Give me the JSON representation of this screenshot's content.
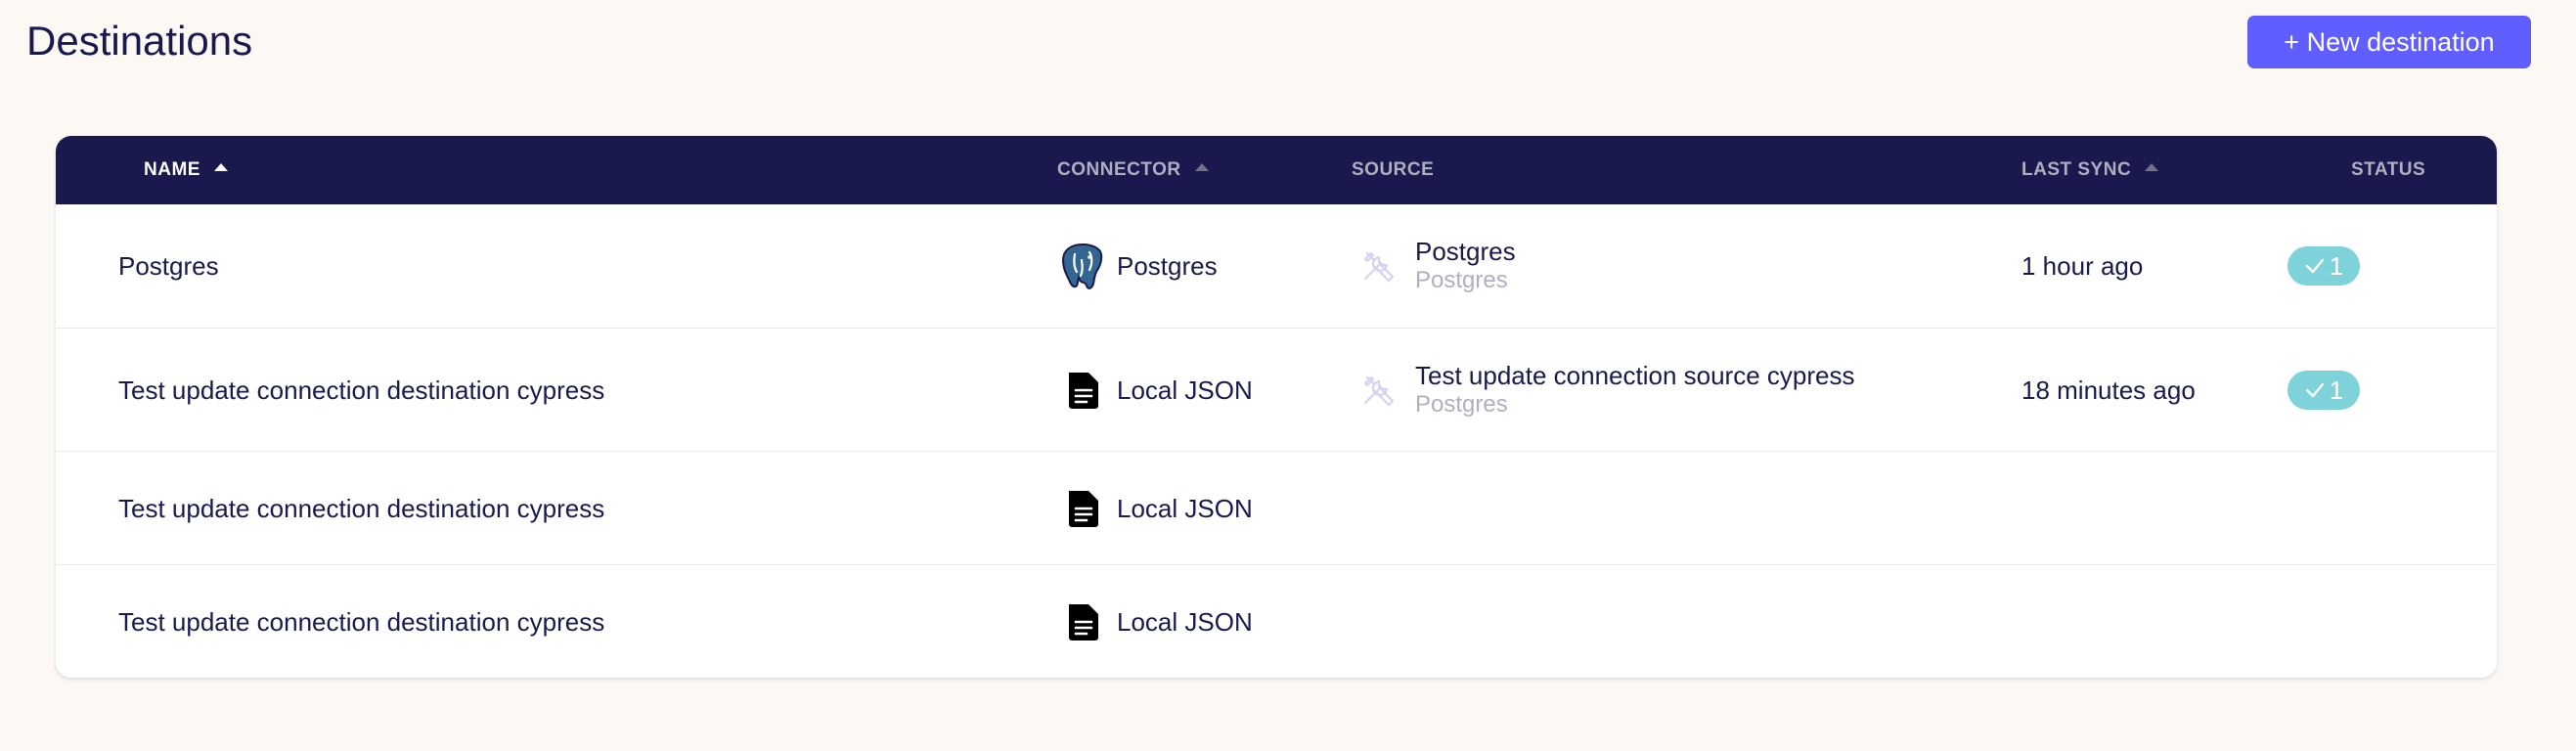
{
  "header": {
    "title": "Destinations",
    "new_button_label": "+ New destination"
  },
  "table": {
    "columns": {
      "name": "NAME",
      "connector": "CONNECTOR",
      "source": "SOURCE",
      "last_sync": "LAST SYNC",
      "status": "STATUS"
    },
    "sort": {
      "active_column": "name",
      "direction": "ascending"
    },
    "rows": [
      {
        "name": "Postgres",
        "connector": "Postgres",
        "connector_icon": "postgres-elephant-icon",
        "source_name": "Postgres",
        "source_type": "Postgres",
        "source_icon": "tools-icon",
        "last_sync": "1 hour ago",
        "status_count": "1",
        "status_icon": "check-icon"
      },
      {
        "name": "Test update connection destination cypress",
        "connector": "Local JSON",
        "connector_icon": "file-document-icon",
        "source_name": "Test update connection source cypress",
        "source_type": "Postgres",
        "source_icon": "tools-icon",
        "last_sync": "18 minutes ago",
        "status_count": "1",
        "status_icon": "check-icon"
      },
      {
        "name": "Test update connection destination cypress",
        "connector": "Local JSON",
        "connector_icon": "file-document-icon"
      },
      {
        "name": "Test update connection destination cypress",
        "connector": "Local JSON",
        "connector_icon": "file-document-icon"
      }
    ]
  },
  "colors": {
    "page_background": "#fcf8f4",
    "header_background": "#1a194d",
    "primary_button": "#615eff",
    "status_success": "#7ed3da",
    "text_primary": "#1a194d",
    "text_secondary": "#afafc1"
  }
}
